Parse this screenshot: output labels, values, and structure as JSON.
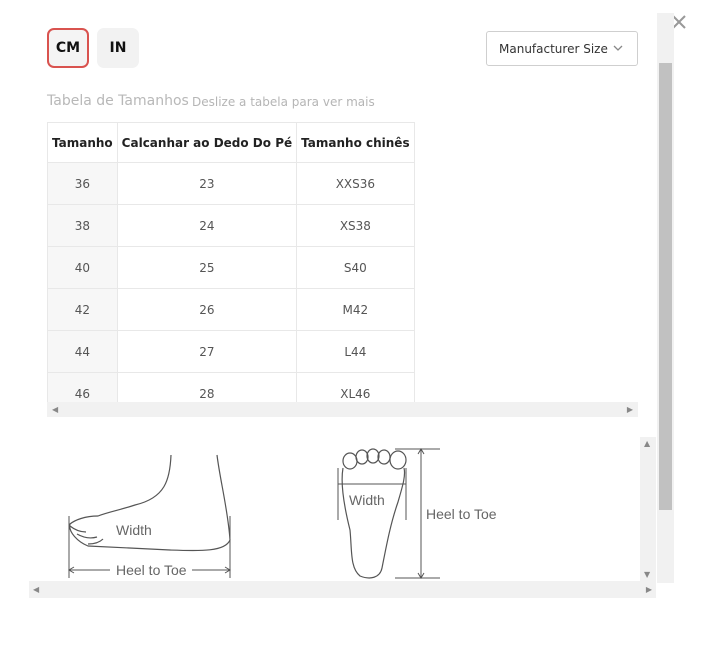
{
  "units": {
    "cm_label": "CM",
    "in_label": "IN",
    "selected": "CM"
  },
  "dropdown": {
    "selected": "Manufacturer Size",
    "icon": "chevron-down-icon"
  },
  "close_icon": "close-icon",
  "table": {
    "title": "Tabela de Tamanhos",
    "hint": "Deslize a tabela para ver mais",
    "headers": [
      "Tamanho",
      "Calcanhar ao Dedo Do Pé",
      "Tamanho chinês"
    ],
    "rows": [
      [
        "36",
        "23",
        "XXS36"
      ],
      [
        "38",
        "24",
        "XS38"
      ],
      [
        "40",
        "25",
        "S40"
      ],
      [
        "42",
        "26",
        "M42"
      ],
      [
        "44",
        "27",
        "L44"
      ],
      [
        "46",
        "28",
        "XL46"
      ]
    ]
  },
  "diagram": {
    "side": {
      "width_label": "Width",
      "length_label": "Heel to Toe"
    },
    "sole": {
      "width_label": "Width",
      "length_label": "Heel to Toe"
    }
  },
  "colors": {
    "selected_border": "#d9534f",
    "scrollbar_thumb": "#c1c1c1",
    "muted_text": "#b8b8b8"
  }
}
